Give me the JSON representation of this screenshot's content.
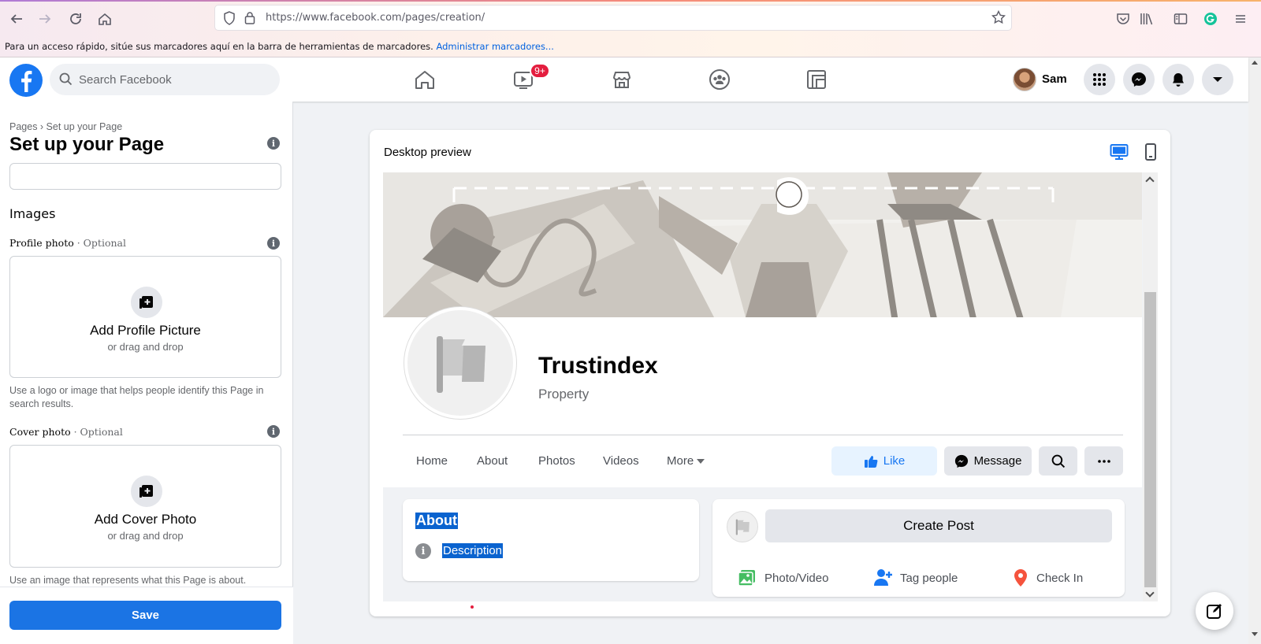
{
  "browser": {
    "url": "https://www.facebook.com/pages/creation/",
    "bookmarks_text": "Para un acceso rápido, sitúe sus marcadores aquí en la barra de herramientas de marcadores.",
    "bookmarks_link": "Administrar marcadores..."
  },
  "fb_header": {
    "search_placeholder": "Search Facebook",
    "watch_badge": "9+",
    "user_name": "Sam"
  },
  "left_panel": {
    "breadcrumb": "Pages › Set up your Page",
    "title": "Set up your Page",
    "images_heading": "Images",
    "profile_label": "Profile photo",
    "profile_optional": " · Optional",
    "profile_title": "Add Profile Picture",
    "profile_sub": "or drag and drop",
    "profile_hint": "Use a logo or image that helps people identify this Page in search results.",
    "cover_label": "Cover photo",
    "cover_optional": " · Optional",
    "cover_title": "Add Cover Photo",
    "cover_sub": "or drag and drop",
    "cover_hint": "Use an image that represents what this Page is about.",
    "save_label": "Save"
  },
  "preview": {
    "label": "Desktop preview",
    "page_name": "Trustindex",
    "page_category": "Property",
    "tabs": [
      "Home",
      "About",
      "Photos",
      "Videos",
      "More"
    ],
    "like_label": "Like",
    "message_label": "Message",
    "about_heading": "About",
    "description_label": "Description",
    "create_post_label": "Create Post",
    "photo_video_label": "Photo/Video",
    "tag_people_label": "Tag people",
    "check_in_label": "Check In"
  },
  "colors": {
    "fb_blue": "#1877f2",
    "save_blue": "#1b74e4",
    "badge_red": "#e41e3f",
    "selection": "#0a63cf"
  }
}
